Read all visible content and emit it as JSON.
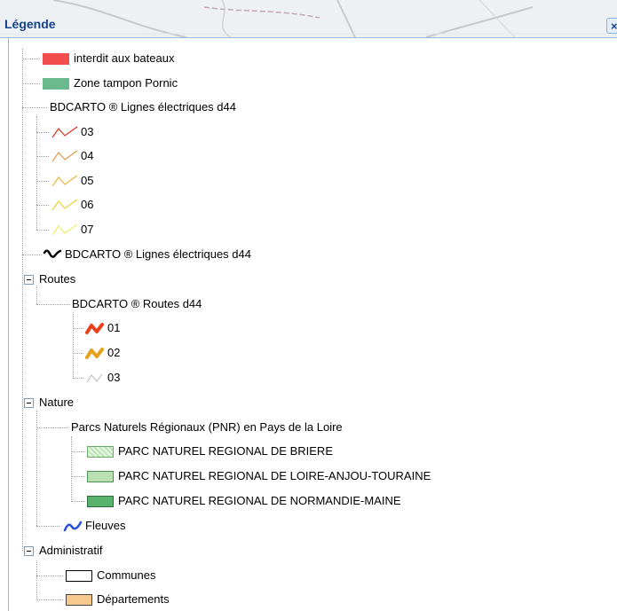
{
  "panel": {
    "title": "Légende",
    "close_label": "×"
  },
  "legend": {
    "top_items": [
      {
        "label": "interdit aux bateaux",
        "swatch": "#f24d4d"
      },
      {
        "label": "Zone tampon Pornic",
        "swatch": "#6bb98c"
      }
    ],
    "lignes_group": {
      "title": "BDCARTO ® Lignes électriques d44",
      "items": [
        {
          "label": "03",
          "color": "#d83020"
        },
        {
          "label": "04",
          "color": "#e39a4a"
        },
        {
          "label": "05",
          "color": "#e6b93c"
        },
        {
          "label": "06",
          "color": "#e8d23a"
        },
        {
          "label": "07",
          "color": "#f0ee6a"
        }
      ]
    },
    "lignes_single": {
      "label": "BDCARTO ® Lignes électriques d44",
      "color": "#000000"
    },
    "routes": {
      "title": "Routes",
      "subgroup": "BDCARTO ® Routes d44",
      "items": [
        {
          "label": "01",
          "color": "#e8401c"
        },
        {
          "label": "02",
          "color": "#e3a21a"
        },
        {
          "label": "03",
          "color": "#b8b8b8"
        }
      ]
    },
    "nature": {
      "title": "Nature",
      "subgroup": "Parcs Naturels Régionaux (PNR) en Pays de la Loire",
      "items": [
        {
          "label": "PARC NATUREL REGIONAL DE BRIERE"
        },
        {
          "label": "PARC NATUREL REGIONAL DE LOIRE-ANJOU-TOURAINE"
        },
        {
          "label": "PARC NATUREL REGIONAL DE NORMANDIE-MAINE"
        }
      ],
      "fleuves": {
        "label": "Fleuves",
        "color": "#2a4fd8"
      }
    },
    "administratif": {
      "title": "Administratif",
      "items": [
        {
          "label": "Communes"
        },
        {
          "label": "Départements"
        }
      ]
    }
  }
}
